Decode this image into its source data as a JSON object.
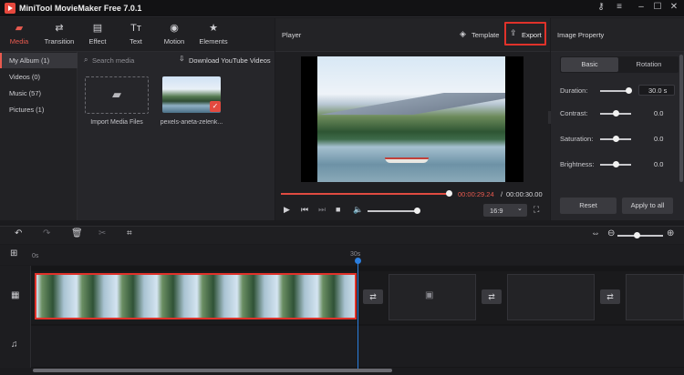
{
  "app": {
    "title": "MiniTool MovieMaker Free 7.0.1"
  },
  "tabs": [
    {
      "label": "Media",
      "icon": "folder-icon"
    },
    {
      "label": "Transition",
      "icon": "transition-icon"
    },
    {
      "label": "Effect",
      "icon": "effect-icon"
    },
    {
      "label": "Text",
      "icon": "text-icon"
    },
    {
      "label": "Motion",
      "icon": "motion-icon"
    },
    {
      "label": "Elements",
      "icon": "elements-icon"
    }
  ],
  "albums": [
    {
      "label": "My Album  (1)"
    },
    {
      "label": "Videos  (0)"
    },
    {
      "label": "Music  (57)"
    },
    {
      "label": "Pictures  (1)"
    }
  ],
  "media": {
    "search_placeholder": "Search media",
    "download_label": "Download YouTube Videos",
    "import_label": "Import Media Files",
    "clip_label": "pexels-aneta-zelenk..."
  },
  "player": {
    "title": "Player",
    "template_label": "Template",
    "export_label": "Export",
    "time_current": "00:00:29.24",
    "time_sep": "/",
    "time_total": "00:00:30.00",
    "progress": 1.0,
    "volume": 0.9,
    "aspect_ratio": "16:9"
  },
  "properties": {
    "title": "Image Property",
    "tab_basic": "Basic",
    "tab_rotation": "Rotation",
    "duration_label": "Duration:",
    "duration_value": "30.0 s",
    "contrast_label": "Contrast:",
    "contrast_value": "0.0",
    "saturation_label": "Saturation:",
    "saturation_value": "0.0",
    "brightness_label": "Brightness:",
    "brightness_value": "0.0",
    "reset_label": "Reset",
    "apply_label": "Apply to all"
  },
  "timeline": {
    "tick_start": "0s",
    "tick_30": "30s"
  },
  "colors": {
    "accent": "#e85a4f",
    "export_highlight": "#e0322a",
    "playhead": "#2b7fe0",
    "background": "#1b1b1e"
  }
}
